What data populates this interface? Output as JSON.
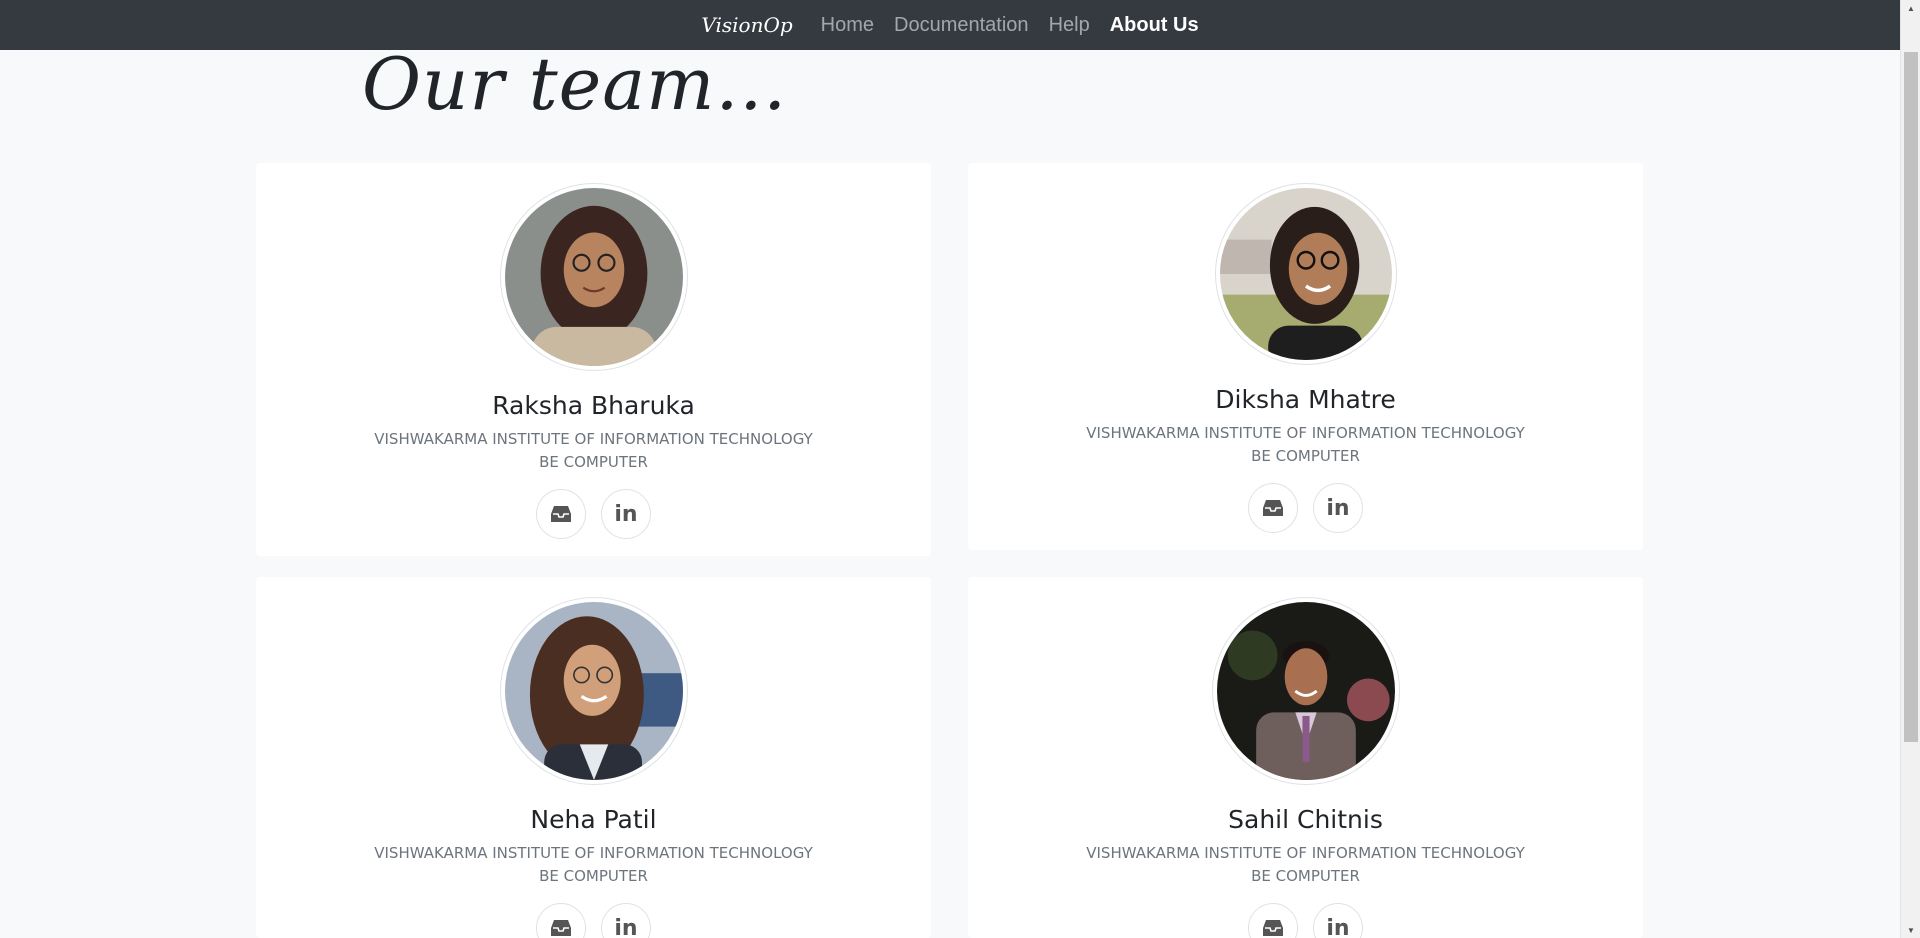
{
  "navbar": {
    "brand": "VisionOp",
    "links": [
      "Home",
      "Documentation",
      "Help",
      "About Us"
    ]
  },
  "page": {
    "heading": "Our team..."
  },
  "team": [
    {
      "name": "Raksha Bharuka",
      "institute": "VISHWAKARMA INSTITUTE OF INFORMATION TECHNOLOGY",
      "department": "BE COMPUTER",
      "social": [
        "inbox-icon",
        "linkedin-icon"
      ]
    },
    {
      "name": "Diksha Mhatre",
      "institute": "VISHWAKARMA INSTITUTE OF INFORMATION TECHNOLOGY",
      "department": "BE COMPUTER",
      "social": [
        "inbox-icon",
        "linkedin-icon"
      ]
    },
    {
      "name": "Neha Patil",
      "institute": "VISHWAKARMA INSTITUTE OF INFORMATION TECHNOLOGY",
      "department": "BE COMPUTER",
      "social": [
        "inbox-icon",
        "linkedin-icon"
      ]
    },
    {
      "name": "Sahil Chitnis",
      "institute": "VISHWAKARMA INSTITUTE OF INFORMATION TECHNOLOGY",
      "department": "BE COMPUTER",
      "social": [
        "inbox-icon",
        "linkedin-icon"
      ]
    }
  ],
  "icons": {
    "linkedin_glyph": "in"
  },
  "colors": {
    "navbar_bg": "#343a40",
    "page_bg": "#f8f9fa",
    "muted_text": "#6c757d"
  }
}
